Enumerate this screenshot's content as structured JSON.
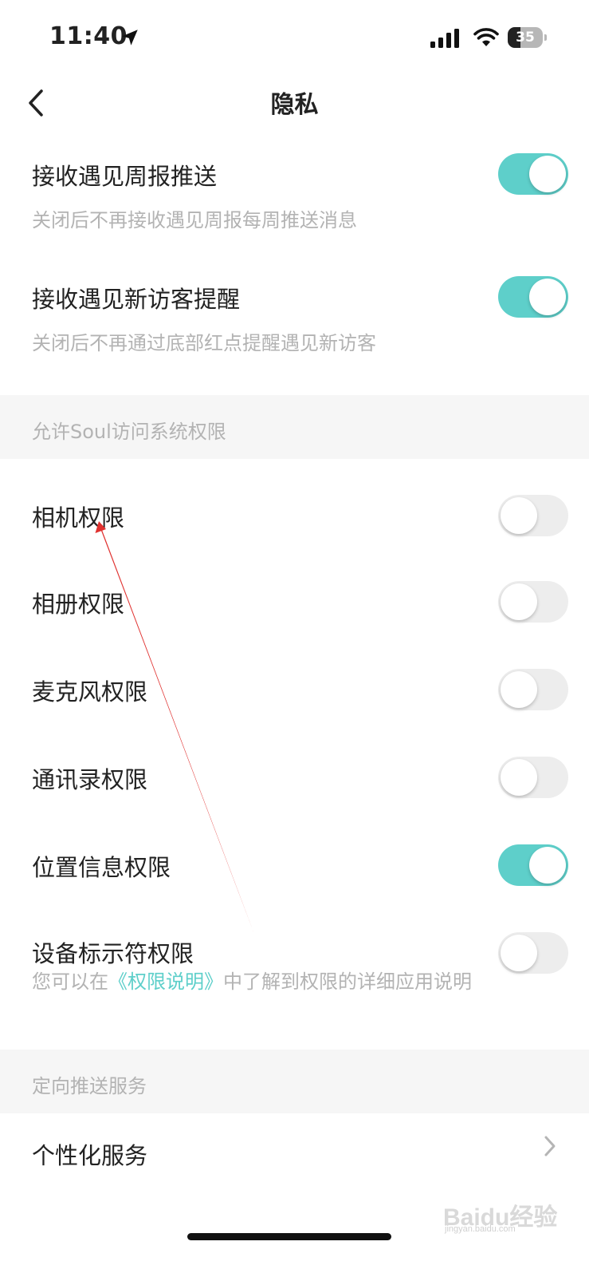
{
  "status_bar": {
    "time": "11:40",
    "battery": "35",
    "icons": [
      "location-arrow-icon",
      "signal-icon",
      "wifi-icon",
      "battery-icon"
    ]
  },
  "nav": {
    "title": "隐私",
    "back_icon": "chevron-left-icon"
  },
  "settings": [
    {
      "title": "接收遇见周报推送",
      "desc": "关闭后不再接收遇见周报每周推送消息",
      "on": true
    },
    {
      "title": "接收遇见新访客提醒",
      "desc": "关闭后不再通过底部红点提醒遇见新访客",
      "on": true
    }
  ],
  "permissions_section": {
    "header": "允许Soul访问系统权限",
    "items": [
      {
        "title": "相机权限",
        "on": false
      },
      {
        "title": "相册权限",
        "on": false
      },
      {
        "title": "麦克风权限",
        "on": false
      },
      {
        "title": "通讯录权限",
        "on": false
      },
      {
        "title": "位置信息权限",
        "on": true
      },
      {
        "title": "设备标示符权限",
        "on": false
      }
    ],
    "note_prefix": "您可以在",
    "note_link": "《权限说明》",
    "note_suffix": "中了解到权限的详细应用说明"
  },
  "push_section": {
    "header": "定向推送服务",
    "item": "个性化服务"
  },
  "watermark": {
    "text": "Baidu经验",
    "sub": "jingyan.baidu.com"
  },
  "colors": {
    "toggle_on": "#5ecfca",
    "toggle_off": "#ededed",
    "link": "#5ecfca",
    "annotation_arrow": "#e0312f",
    "section_bg": "#f6f6f6"
  }
}
